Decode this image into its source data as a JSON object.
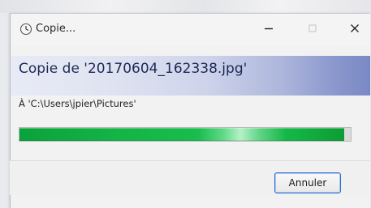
{
  "window": {
    "title": "Copie...",
    "icons": {
      "title": "clock-icon",
      "minimize": "minimize-icon",
      "maximize": "maximize-icon",
      "close": "close-icon"
    }
  },
  "copy": {
    "heading": "Copie de '20170604_162338.jpg'",
    "destination": "À 'C:\\Users\\jpier\\Pictures'",
    "progress_fraction": 0.98
  },
  "actions": {
    "cancel_label": "Annuler"
  },
  "colors": {
    "progress_green": "#14b447",
    "header_gradient_end": "#7a89c6",
    "button_border": "#2f6fcf"
  }
}
